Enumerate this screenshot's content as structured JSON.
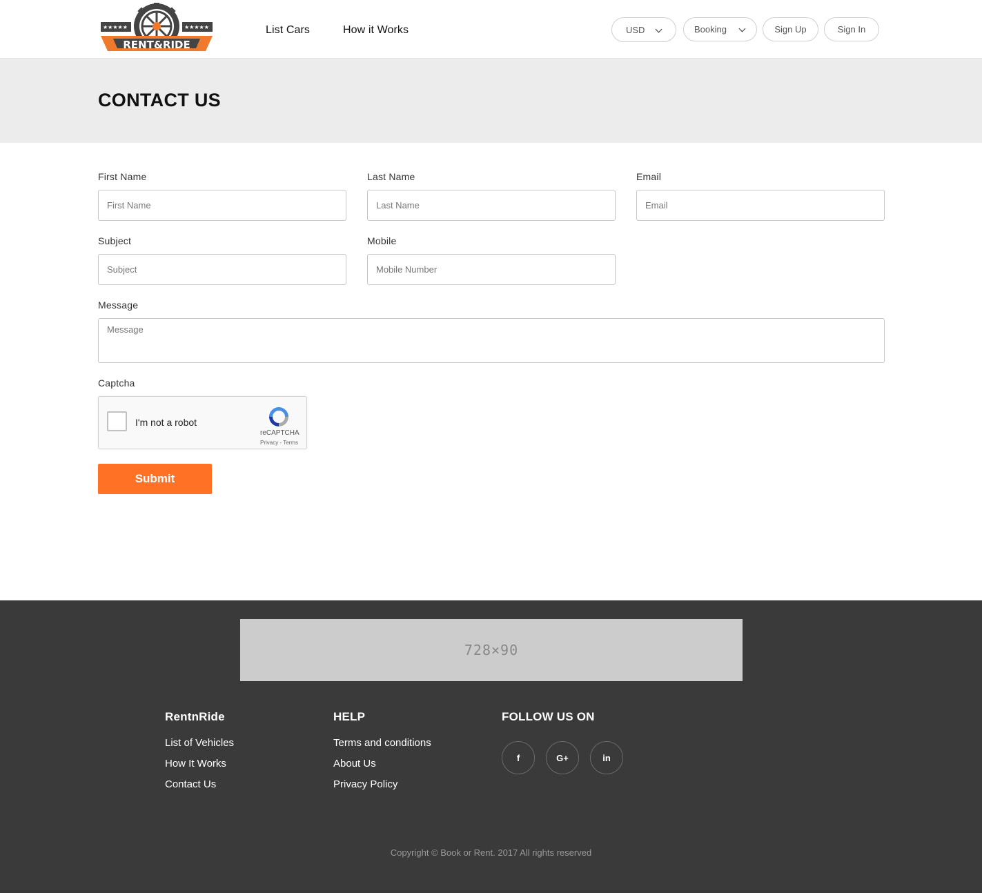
{
  "brand": {
    "logo_text": "RENT&RIDE",
    "accent_color": "#f07a2b",
    "dark_color": "#444444"
  },
  "nav": {
    "list_cars": "List Cars",
    "how_it_works": "How it Works"
  },
  "header_controls": {
    "currency": "USD",
    "booking": "Booking",
    "sign_up": "Sign Up",
    "sign_in": "Sign In"
  },
  "page_title": "CONTACT US",
  "form": {
    "first_name": {
      "label": "First Name",
      "placeholder": "First Name"
    },
    "last_name": {
      "label": "Last Name",
      "placeholder": "Last Name"
    },
    "email": {
      "label": "Email",
      "placeholder": "Email"
    },
    "subject": {
      "label": "Subject",
      "placeholder": "Subject"
    },
    "mobile": {
      "label": "Mobile",
      "placeholder": "Mobile Number"
    },
    "message": {
      "label": "Message",
      "placeholder": "Message"
    },
    "captcha": {
      "label": "Captcha",
      "checkbox_text": "I'm not a robot",
      "brand": "reCAPTCHA",
      "links": "Privacy - Terms"
    },
    "submit_label": "Submit",
    "submit_color": "#ff7225"
  },
  "footer": {
    "ad_text": "728×90",
    "col1": {
      "title": "RentnRide",
      "links": [
        "List of Vehicles",
        "How It Works",
        "Contact Us"
      ]
    },
    "col2": {
      "title": "HELP",
      "links": [
        "Terms and conditions",
        "About Us",
        "Privacy Policy"
      ]
    },
    "col3": {
      "title": "FOLLOW US ON",
      "social": [
        "f",
        "G+",
        "in"
      ]
    },
    "copyright": "Copyright © Book or Rent. 2017 All rights reserved",
    "bg_color": "#3a3a3a"
  }
}
